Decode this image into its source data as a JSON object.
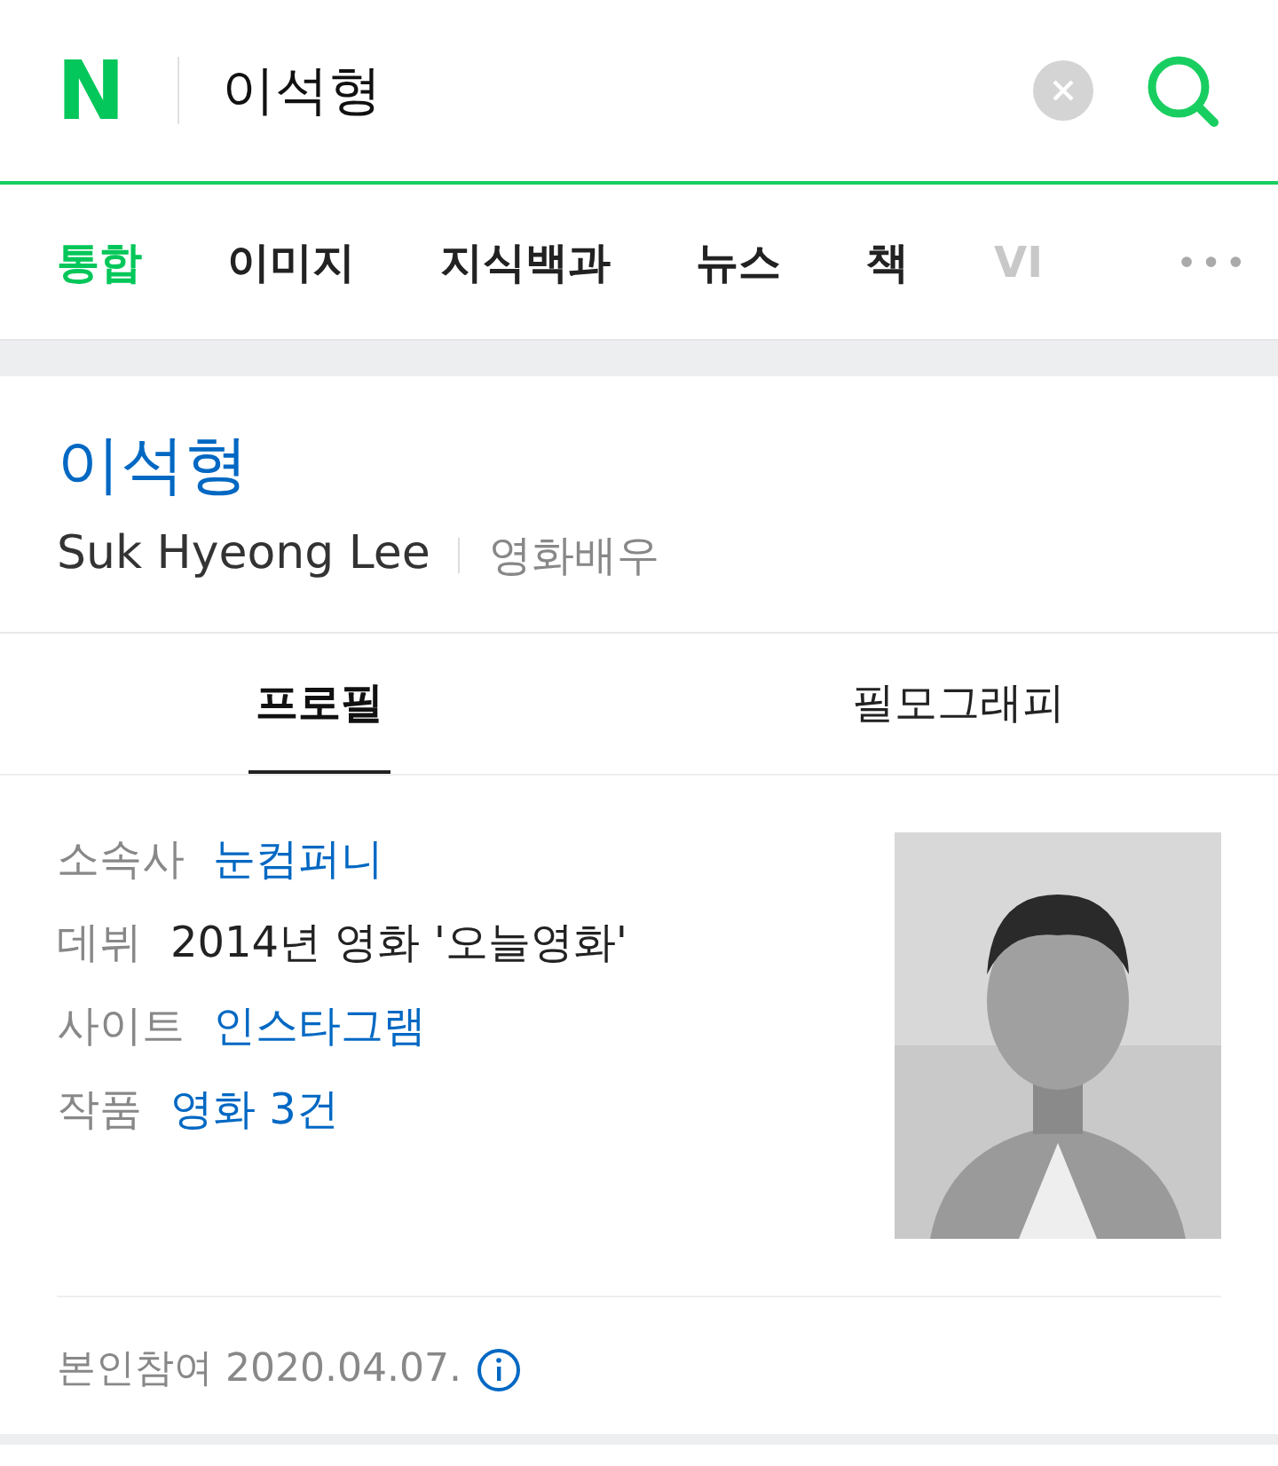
{
  "search": {
    "logo": "N",
    "value": "이석형"
  },
  "tabs": [
    {
      "label": "통합",
      "selected": true
    },
    {
      "label": "이미지",
      "selected": false
    },
    {
      "label": "지식백과",
      "selected": false
    },
    {
      "label": "뉴스",
      "selected": false
    },
    {
      "label": "책",
      "selected": false
    },
    {
      "label": "VI",
      "selected": false
    }
  ],
  "more": "•••",
  "profile": {
    "name": "이석형",
    "english_name": "Suk Hyeong Lee",
    "occupation": "영화배우"
  },
  "subtabs": [
    {
      "label": "프로필",
      "selected": true
    },
    {
      "label": "필모그래피",
      "selected": false
    }
  ],
  "info": [
    {
      "label": "소속사",
      "value": "눈컴퍼니",
      "link": true
    },
    {
      "label": "데뷔",
      "value": "2014년 영화 '오늘영화'",
      "link": false
    },
    {
      "label": "사이트",
      "value": "인스타그램",
      "link": true
    },
    {
      "label": "작품",
      "value": "영화 3건",
      "link": true
    }
  ],
  "footer": "본인참여 2020.04.07."
}
